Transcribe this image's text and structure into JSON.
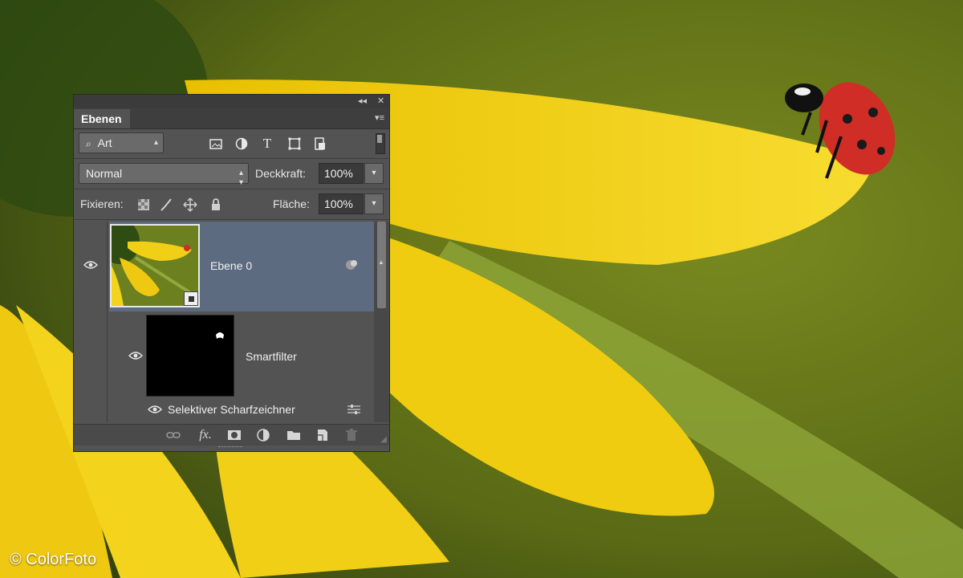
{
  "watermark": "© ColorFoto",
  "panel": {
    "tab_label": "Ebenen",
    "collapse_icon": "double-chevron-left-icon",
    "close_icon": "close-icon",
    "menu_icon": "panel-menu-icon",
    "filter": {
      "kind_value": "Art",
      "icons": [
        "image-filter-icon",
        "adjustment-filter-icon",
        "type-filter-icon",
        "shape-filter-icon",
        "smart-object-filter-icon"
      ]
    },
    "blend_mode": "Normal",
    "opacity_label": "Deckkraft:",
    "opacity_value": "100%",
    "lock_label": "Fixieren:",
    "lock_icons": [
      "lock-transparent-icon",
      "lock-image-icon",
      "lock-position-icon",
      "lock-all-icon"
    ],
    "fill_label": "Fläche:",
    "fill_value": "100%",
    "layers": [
      {
        "name": "Ebene 0",
        "selected": true,
        "visible": true
      },
      {
        "name": "Smartfilter",
        "visible": true
      },
      {
        "name": "Selektiver Scharfzeichner",
        "visible": true
      }
    ],
    "bottom_icons": [
      "link-icon",
      "fx-icon",
      "mask-icon",
      "adjustment-icon",
      "folder-icon",
      "new-layer-icon",
      "trash-icon"
    ]
  },
  "colors": {
    "panel_bg": "#535353",
    "selection": "#5d6b80",
    "petal_yellow": "#f2cf17",
    "background_green": "#6b7a1c"
  }
}
